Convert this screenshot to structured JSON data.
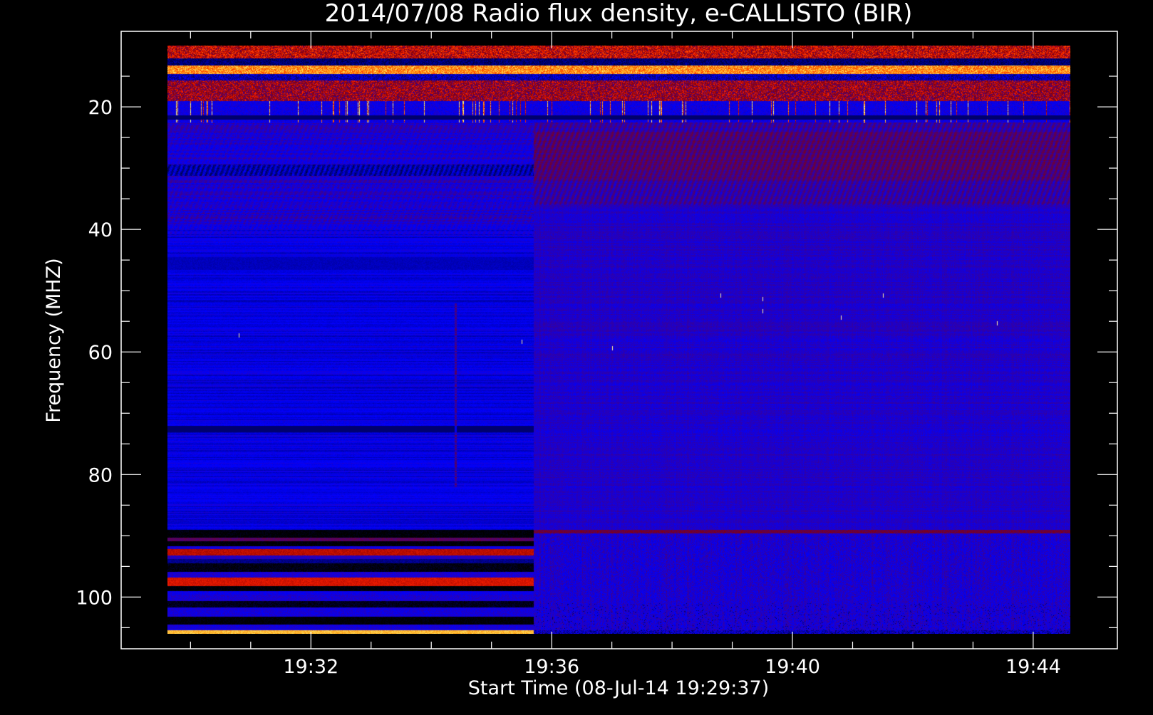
{
  "chart_data": {
    "type": "heatmap",
    "title": "2014/07/08  Radio flux density, e-CALLISTO (BIR)",
    "xlabel": "Start Time (08-Jul-14 19:29:37)",
    "ylabel": "Frequency (MHZ)",
    "x_ticks": [
      "19:32",
      "19:36",
      "19:40",
      "19:44"
    ],
    "x_tick_minutes": [
      32,
      36,
      40,
      44
    ],
    "x_range_minutes": [
      29.617,
      44.617
    ],
    "y_ticks": [
      20,
      40,
      60,
      80,
      100
    ],
    "y_range": [
      10,
      106
    ],
    "y_inverted": true,
    "mode_change_minute": 35.7,
    "colormap": [
      "#000000",
      "#0000ff",
      "#8b0000",
      "#ff2000",
      "#ff8c00",
      "#ffff80"
    ],
    "features": [
      {
        "kind": "band",
        "freq": [
          10,
          12
        ],
        "intensity": "high"
      },
      {
        "kind": "band",
        "freq": [
          13.5,
          14.5
        ],
        "intensity": "very-high"
      },
      {
        "kind": "band",
        "freq": [
          15,
          22.5
        ],
        "intensity": "bursty"
      },
      {
        "kind": "band",
        "freq": [
          29.5,
          31
        ],
        "intensity": "low",
        "minutes": [
          29.617,
          35.7
        ]
      },
      {
        "kind": "band",
        "freq": [
          89,
          106
        ],
        "intensity": "striped",
        "minutes": [
          29.617,
          35.7
        ]
      },
      {
        "kind": "band",
        "freq": [
          105.5,
          106
        ],
        "intensity": "very-high",
        "minutes": [
          29.617,
          35.7
        ]
      }
    ]
  }
}
